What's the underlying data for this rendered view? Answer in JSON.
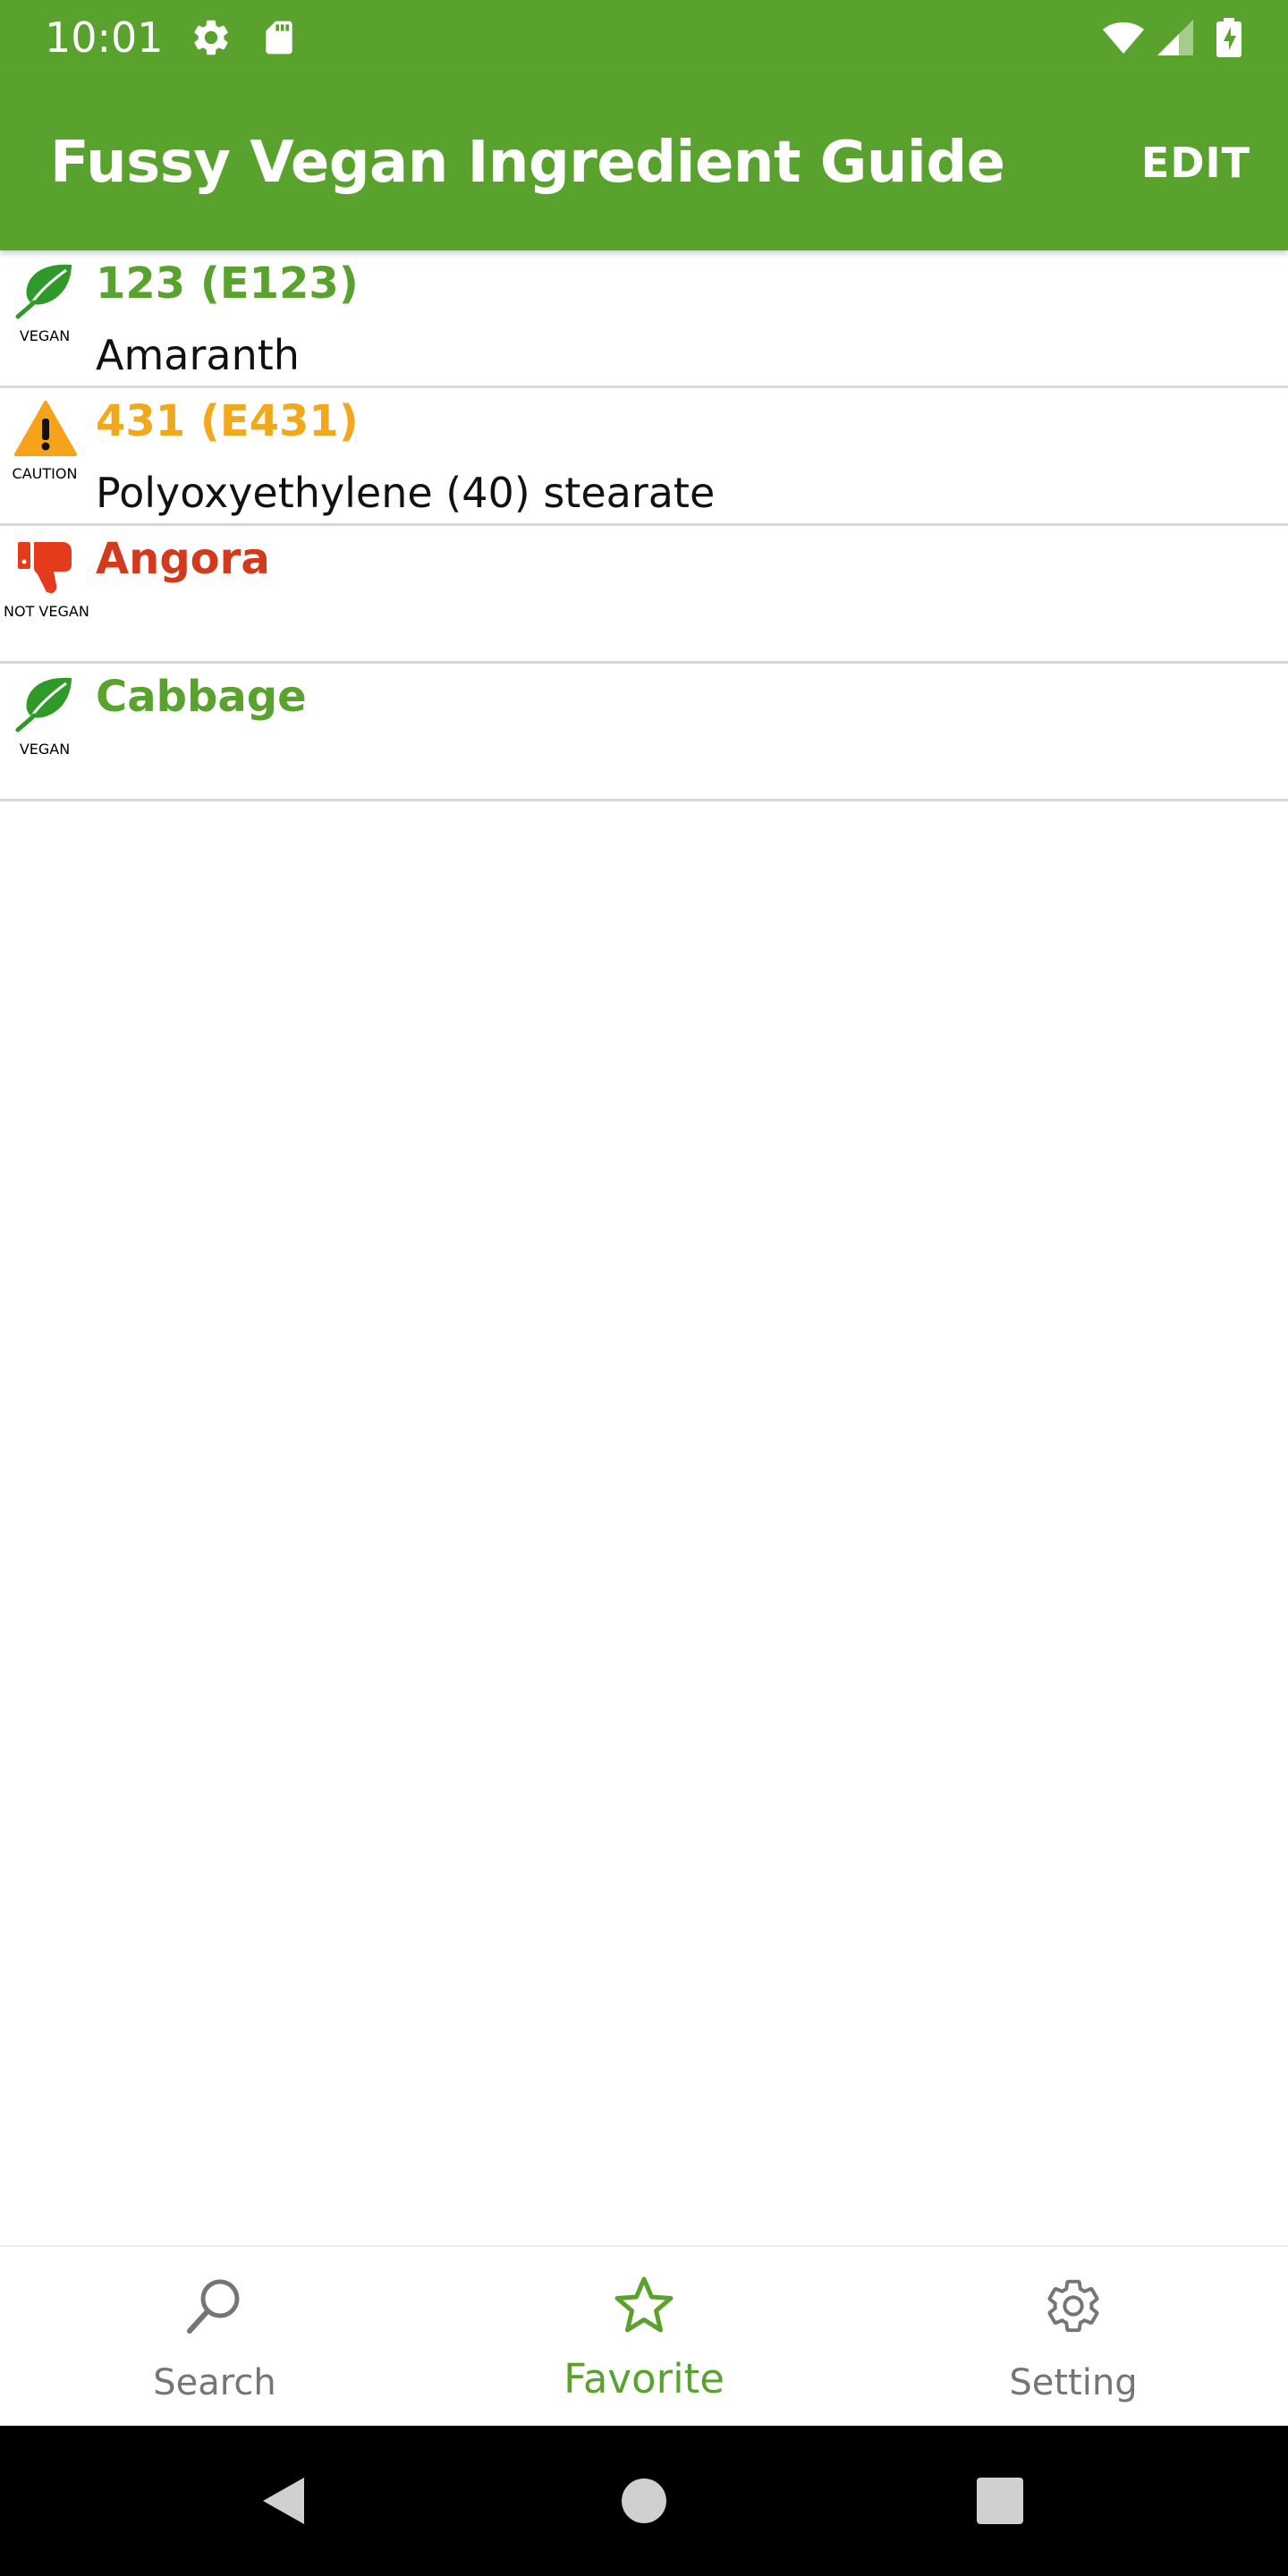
{
  "status_bar": {
    "time": "10:01",
    "icons": [
      "settings-icon",
      "sd-card-icon",
      "wifi-icon",
      "signal-icon",
      "battery-charging-icon"
    ]
  },
  "app_bar": {
    "title": "Fussy Vegan Ingredient Guide",
    "edit_label": "EDIT",
    "color": "#5aa22e"
  },
  "favorites": [
    {
      "status": "vegan",
      "badge": "VEGAN",
      "icon": "leaf-icon",
      "title": "123 (E123)",
      "subtitle": "Amaranth",
      "color": "#5aa22e"
    },
    {
      "status": "caution",
      "badge": "CAUTION",
      "icon": "warning-icon",
      "title": "431 (E431)",
      "subtitle": "Polyoxyethylene (40) stearate",
      "color": "#f2a81d"
    },
    {
      "status": "not-vegan",
      "badge": "NOT VEGAN",
      "icon": "thumbs-down-icon",
      "title": "Angora",
      "subtitle": "",
      "color": "#d23a1e"
    },
    {
      "status": "vegan",
      "badge": "VEGAN",
      "icon": "leaf-icon",
      "title": "Cabbage",
      "subtitle": "",
      "color": "#5aa22e"
    }
  ],
  "bottom_nav": {
    "items": [
      {
        "label": "Search",
        "icon": "search-icon",
        "active": false
      },
      {
        "label": "Favorite",
        "icon": "star-icon",
        "active": true
      },
      {
        "label": "Setting",
        "icon": "gear-icon",
        "active": false
      }
    ],
    "active_color": "#5aa22e",
    "inactive_color": "#757575"
  },
  "system_nav": {
    "buttons": [
      "back-icon",
      "home-icon",
      "recents-icon"
    ]
  }
}
